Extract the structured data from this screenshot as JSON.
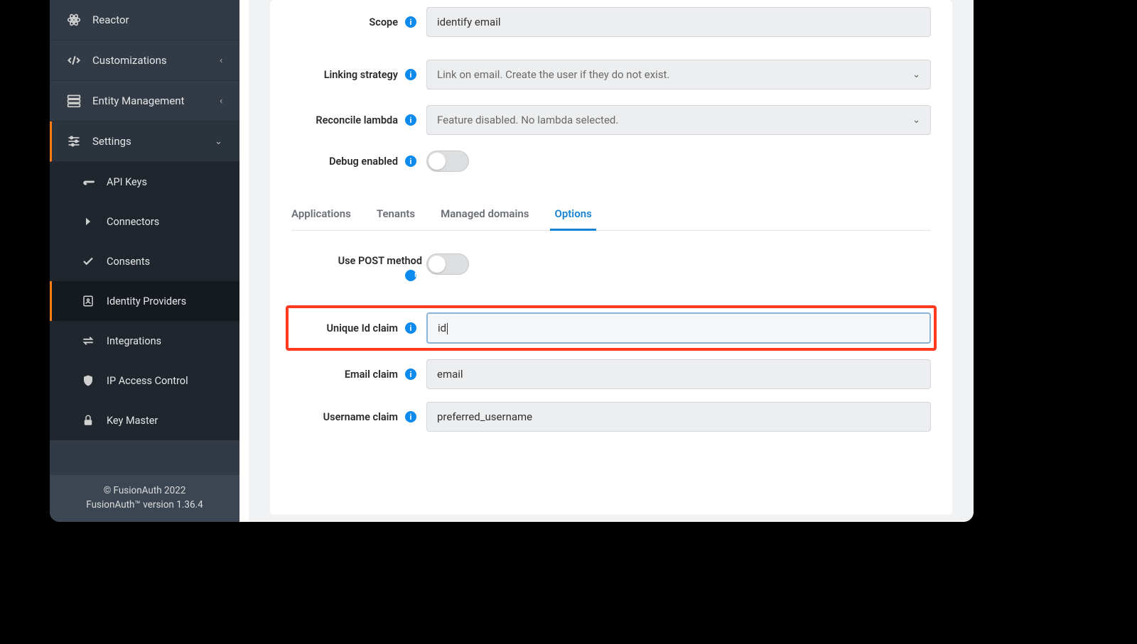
{
  "sidebar": {
    "items": [
      {
        "label": "Reactor"
      },
      {
        "label": "Customizations"
      },
      {
        "label": "Entity Management"
      },
      {
        "label": "Settings"
      }
    ],
    "subitems": [
      {
        "label": "API Keys"
      },
      {
        "label": "Connectors"
      },
      {
        "label": "Consents"
      },
      {
        "label": "Identity Providers"
      },
      {
        "label": "Integrations"
      },
      {
        "label": "IP Access Control"
      },
      {
        "label": "Key Master"
      }
    ]
  },
  "footer": {
    "copyright": "© FusionAuth 2022",
    "version": "FusionAuth™ version 1.36.4"
  },
  "form": {
    "scope_label": "Scope",
    "scope_value": "identify email",
    "linking_label": "Linking strategy",
    "linking_value": "Link on email. Create the user if they do not exist.",
    "reconcile_label": "Reconcile lambda",
    "reconcile_value": "Feature disabled. No lambda selected.",
    "debug_label": "Debug enabled",
    "post_label": "Use POST method",
    "uniqueid_label": "Unique Id claim",
    "uniqueid_value": "id",
    "email_label": "Email claim",
    "email_value": "email",
    "username_label": "Username claim",
    "username_value": "preferred_username"
  },
  "tabs": {
    "applications": "Applications",
    "tenants": "Tenants",
    "managed": "Managed domains",
    "options": "Options"
  }
}
